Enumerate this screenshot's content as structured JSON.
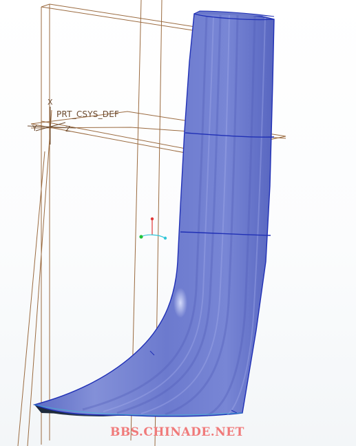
{
  "viewport": {
    "csys_label": "PRT_CSYS_DEF",
    "axis_labels": {
      "x": "X",
      "y": "Y",
      "z": "Z"
    }
  },
  "watermark": {
    "text": "BBS.CHINADE.NET"
  },
  "colors": {
    "datum_plane": "#9a6a3f",
    "surface_fill": "#7d8bd6",
    "surface_edge": "#1f2fb5",
    "surface_shadow": "#2b3a4f",
    "spin_center_x": "#e23636",
    "spin_center_y": "#22c23a",
    "spin_center_z": "#31c6d8",
    "watermark": "#f07a7a"
  }
}
